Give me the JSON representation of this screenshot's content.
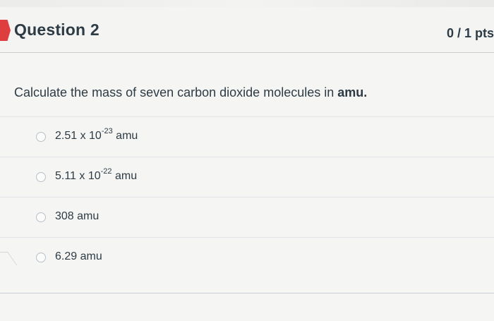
{
  "question": {
    "title": "Question 2",
    "points": "0 / 1 pts",
    "text_prefix": "Calculate the mass of seven carbon dioxide molecules in ",
    "text_bold": "amu."
  },
  "answers": [
    {
      "base": "2.51 x 10",
      "exponent": "-23",
      "unit": " amu",
      "label": "2.51 x 10-23 amu"
    },
    {
      "base": "5.11 x 10",
      "exponent": "-22",
      "unit": " amu",
      "label": "5.11 x 10-22 amu"
    },
    {
      "base": "308 amu",
      "exponent": "",
      "unit": "",
      "label": "308 amu"
    },
    {
      "base": "6.29 amu",
      "exponent": "",
      "unit": "",
      "label": "6.29 amu"
    }
  ],
  "colors": {
    "accent": "#df3e3e",
    "text": "#2d3b45",
    "divider": "#c7cdd1"
  }
}
